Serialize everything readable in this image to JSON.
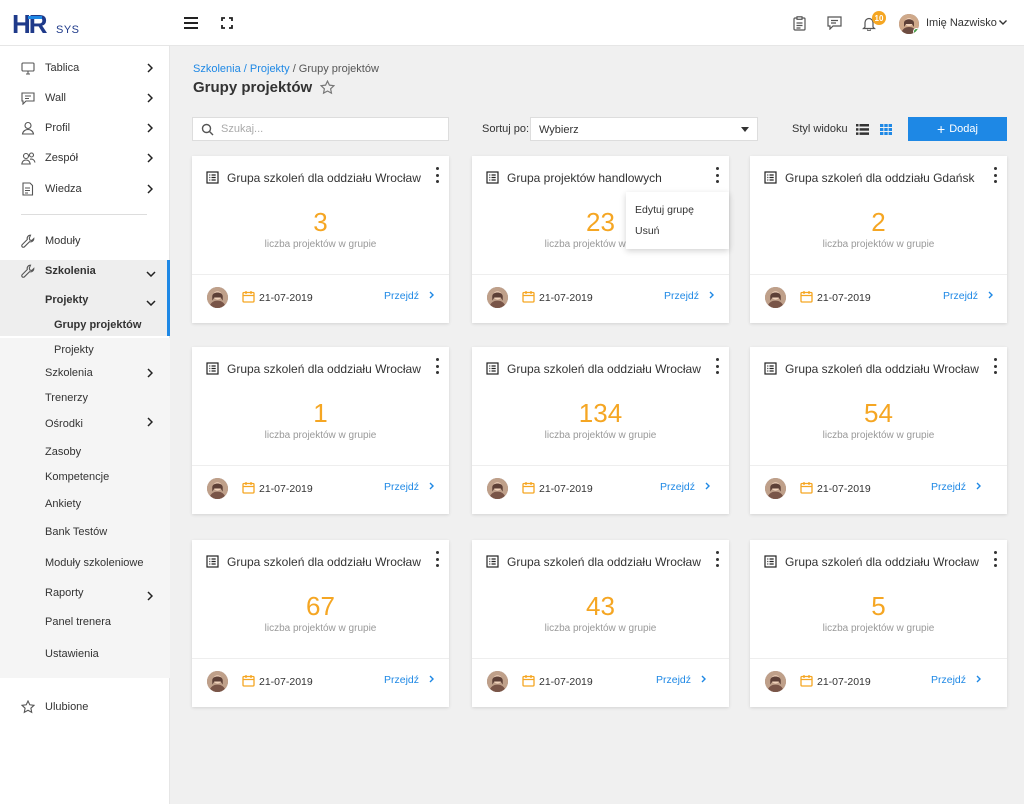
{
  "app": {
    "logo_main": "HR",
    "logo_sub": "SYS"
  },
  "topbar": {
    "notifications_count": "10",
    "user_name": "Imię Nazwisko"
  },
  "sidebar": {
    "items": [
      {
        "label": "Tablica"
      },
      {
        "label": "Wall"
      },
      {
        "label": "Profil"
      },
      {
        "label": "Zespół"
      },
      {
        "label": "Wiedza"
      },
      {
        "label": "Moduły"
      },
      {
        "label": "Szkolenia"
      },
      {
        "label": "Projekty"
      },
      {
        "label": "Grupy projektów"
      },
      {
        "label": "Projekty"
      },
      {
        "label": "Szkolenia"
      },
      {
        "label": "Trenerzy"
      },
      {
        "label": "Ośrodki"
      },
      {
        "label": "Zasoby"
      },
      {
        "label": "Kompetencje"
      },
      {
        "label": "Ankiety"
      },
      {
        "label": "Bank Testów"
      },
      {
        "label": "Moduły szkoleniowe"
      },
      {
        "label": "Raporty"
      },
      {
        "label": "Panel trenera"
      },
      {
        "label": "Ustawienia"
      },
      {
        "label": "Ulubione"
      }
    ]
  },
  "breadcrumb": {
    "part1": "Szkolenia",
    "part2": " / Projekty",
    "part3": " / Grupy projektów"
  },
  "page": {
    "title": "Grupy projektów"
  },
  "toolbar": {
    "search_placeholder": "Szukaj...",
    "sort_label": "Sortuj po:",
    "sort_value": "Wybierz",
    "style_label": "Styl widoku",
    "add_label": "Dodaj"
  },
  "cards": [
    {
      "title": "Grupa szkoleń dla oddziału Wrocław",
      "count": "3",
      "subtitle": "liczba projektów w grupie",
      "date": "21-07-2019",
      "go": "Przejdź"
    },
    {
      "title": "Grupa projektów handlowych",
      "count": "23",
      "subtitle": "liczba projektów w grupie",
      "date": "21-07-2019",
      "go": "Przejdź"
    },
    {
      "title": "Grupa szkoleń dla oddziału Gdańsk",
      "count": "2",
      "subtitle": "liczba projektów w grupie",
      "date": "21-07-2019",
      "go": "Przejdź"
    },
    {
      "title": "Grupa szkoleń dla oddziału Wrocław",
      "count": "1",
      "subtitle": "liczba projektów w grupie",
      "date": "21-07-2019",
      "go": "Przejdź"
    },
    {
      "title": "Grupa szkoleń dla oddziału Wrocław",
      "count": "134",
      "subtitle": "liczba projektów w grupie",
      "date": "21-07-2019",
      "go": "Przejdź"
    },
    {
      "title": "Grupa szkoleń dla oddziału Wrocław",
      "count": "54",
      "subtitle": "liczba projektów w grupie",
      "date": "21-07-2019",
      "go": "Przejdź"
    },
    {
      "title": "Grupa szkoleń dla oddziału Wrocław",
      "count": "67",
      "subtitle": "liczba projektów w grupie",
      "date": "21-07-2019",
      "go": "Przejdź"
    },
    {
      "title": "Grupa szkoleń dla oddziału Wrocław",
      "count": "43",
      "subtitle": "liczba projektów w grupie",
      "date": "21-07-2019",
      "go": "Przejdź"
    },
    {
      "title": "Grupa szkoleń dla oddziału Wrocław",
      "count": "5",
      "subtitle": "liczba projektów w grupie",
      "date": "21-07-2019",
      "go": "Przejdź"
    }
  ],
  "card_menu": {
    "edit": "Edytuj grupę",
    "delete": "Usuń"
  },
  "colors": {
    "accent": "#1e88e5",
    "count": "#f5a623",
    "badge": "#f5a623"
  }
}
